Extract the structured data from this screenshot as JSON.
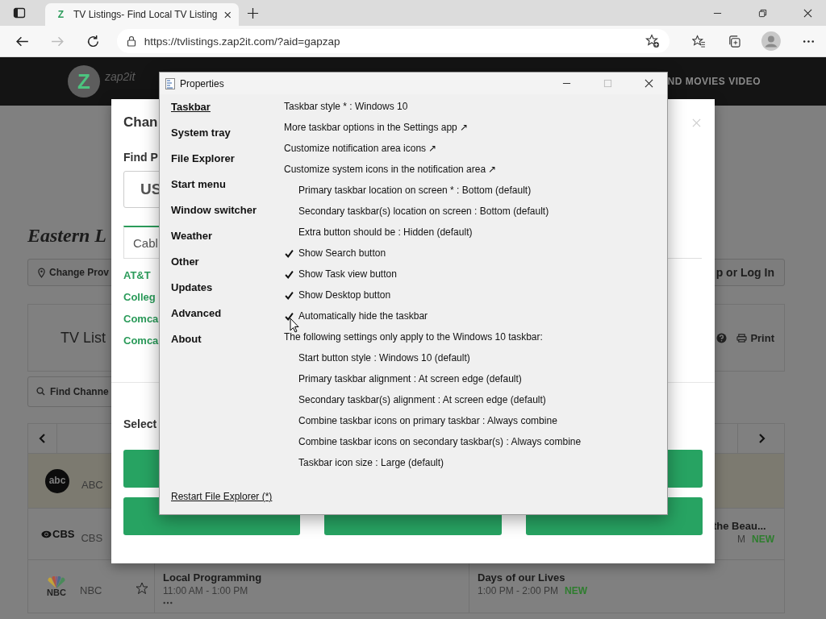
{
  "browser": {
    "tab": {
      "favicon": "Z",
      "title": "TV Listings- Find Local TV Listing"
    },
    "url": "https://tvlistings.zap2it.com/?aid=gapzap",
    "forward_disabled": true
  },
  "site": {
    "logo_mark": "Z",
    "logo_text": "zap2it",
    "nav_fragment": "ND MOVIES VIDEO",
    "heading_fragment": "Eastern L",
    "provider_button": "Change Prov",
    "login_button": "p or Log In",
    "listings_fragment": "TV List",
    "print_button": "Print",
    "search_placeholder": "Find Channe",
    "channels": [
      {
        "kind": "abc",
        "logo": "abc",
        "name": "ABC"
      },
      {
        "kind": "cbs",
        "logo": "CBS",
        "name": "CBS",
        "right_program": {
          "title": "the Beau...",
          "time": "M",
          "badge": "NEW"
        }
      },
      {
        "kind": "nbc",
        "logo": "NBC",
        "name": "NBC",
        "favorite": false,
        "programs": [
          {
            "title": "Local Programming",
            "time": "11:00 AM - 1:00 PM",
            "more": true
          },
          {
            "title": "Days of our Lives",
            "time": "1:00 PM - 2:00 PM",
            "badge": "NEW"
          }
        ]
      }
    ]
  },
  "modal": {
    "title_fragment": "Chan",
    "find_label": "Find P",
    "field_value": "US",
    "tab": "Cabl",
    "providers": [
      "AT&T",
      "Colleg",
      "Comca",
      "Comca"
    ],
    "select_label": "Select",
    "zone_buttons": [
      {
        "kind": "blank"
      },
      {
        "kind": "blank"
      },
      {
        "kind": "blank"
      },
      {
        "kind": "blank"
      },
      {
        "kind": "blank"
      }
    ]
  },
  "properties": {
    "title": "Properties",
    "nav": [
      {
        "label": "Taskbar",
        "selected": true
      },
      {
        "label": "System tray",
        "selected": false
      },
      {
        "label": "File Explorer",
        "selected": false
      },
      {
        "label": "Start menu",
        "selected": false
      },
      {
        "label": "Window switcher",
        "selected": false
      },
      {
        "label": "Weather",
        "selected": false
      },
      {
        "label": "Other",
        "selected": false
      },
      {
        "label": "Updates",
        "selected": false
      },
      {
        "label": "Advanced",
        "selected": false
      },
      {
        "label": "About",
        "selected": false
      }
    ],
    "settings": [
      {
        "kind": "text",
        "label": "Taskbar style * : Windows 10"
      },
      {
        "kind": "link",
        "label": "More taskbar options in the Settings app ↗"
      },
      {
        "kind": "link",
        "label": "Customize notification area icons ↗"
      },
      {
        "kind": "link",
        "label": "Customize system icons in the notification area ↗"
      },
      {
        "kind": "option",
        "label": "Primary taskbar location on screen * : Bottom (default)"
      },
      {
        "kind": "option",
        "label": "Secondary taskbar(s) location on screen : Bottom (default)"
      },
      {
        "kind": "option",
        "label": "Extra button should be : Hidden (default)"
      },
      {
        "kind": "check",
        "label": "Show Search button",
        "checked": true
      },
      {
        "kind": "check",
        "label": "Show Task view button",
        "checked": true
      },
      {
        "kind": "check",
        "label": "Show Desktop button",
        "checked": true
      },
      {
        "kind": "check",
        "label": "Automatically hide the taskbar",
        "checked": true
      },
      {
        "kind": "text",
        "label": "The following settings only apply to the Windows 10 taskbar:"
      },
      {
        "kind": "option",
        "label": "Start button style : Windows 10 (default)"
      },
      {
        "kind": "option",
        "label": "Primary taskbar alignment : At screen edge (default)"
      },
      {
        "kind": "option",
        "label": "Secondary taskbar(s) alignment : At screen edge (default)"
      },
      {
        "kind": "option",
        "label": "Combine taskbar icons on primary taskbar : Always combine"
      },
      {
        "kind": "option",
        "label": "Combine taskbar icons on secondary taskbar(s) : Always combine"
      },
      {
        "kind": "option",
        "label": "Taskbar icon size : Large (default)"
      }
    ],
    "restart_link": "Restart File Explorer (*)"
  }
}
